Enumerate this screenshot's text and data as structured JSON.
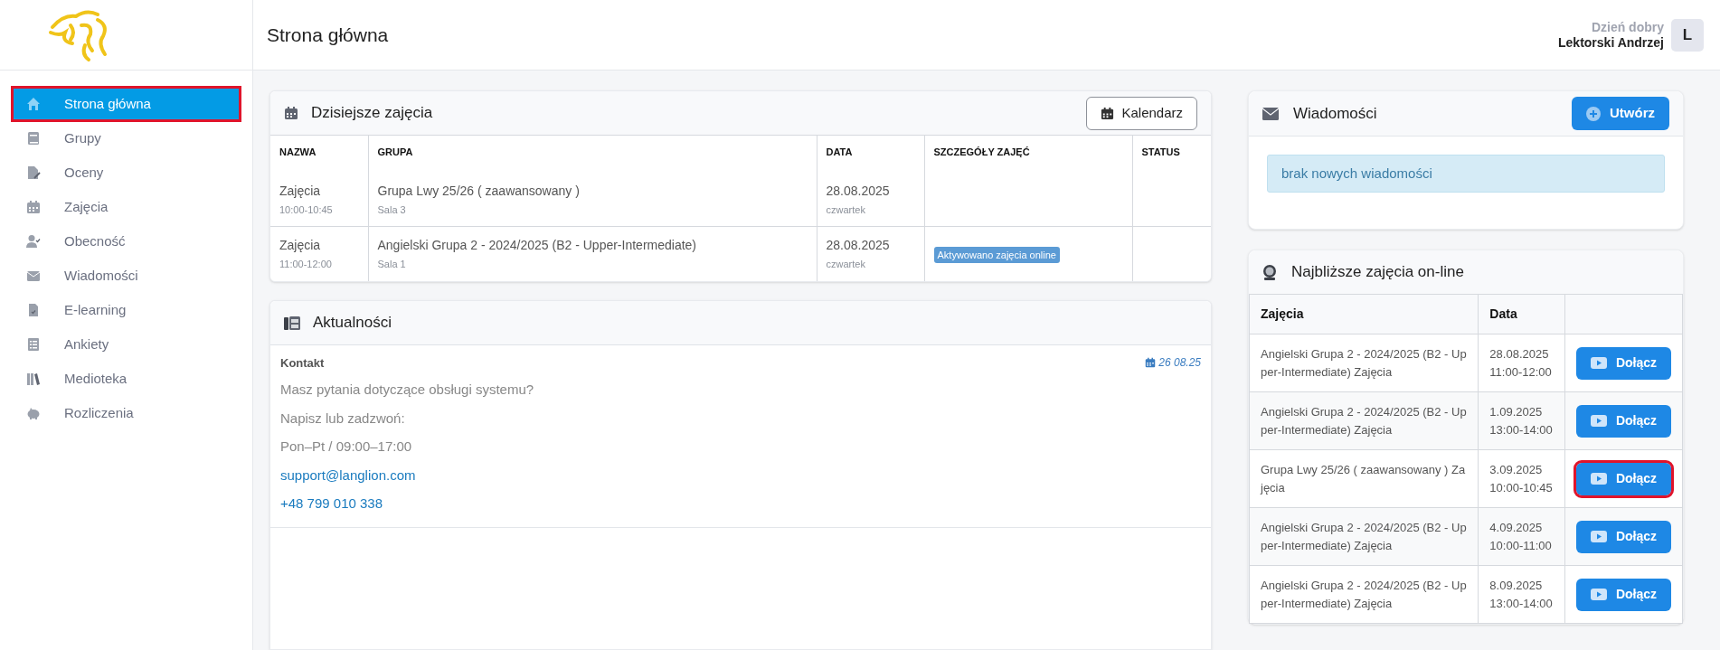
{
  "header": {
    "title": "Strona główna",
    "greeting": "Dzień dobry",
    "user_name": "Lektorski Andrzej",
    "avatar_letter": "L"
  },
  "sidebar": {
    "items": [
      {
        "label": "Strona główna",
        "selected": true,
        "highlighted": true
      },
      {
        "label": "Grupy",
        "selected": false,
        "highlighted": false
      },
      {
        "label": "Oceny",
        "selected": false,
        "highlighted": false
      },
      {
        "label": "Zajęcia",
        "selected": false,
        "highlighted": false
      },
      {
        "label": "Obecność",
        "selected": false,
        "highlighted": false
      },
      {
        "label": "Wiadomości",
        "selected": false,
        "highlighted": false
      },
      {
        "label": "E-learning",
        "selected": false,
        "highlighted": false
      },
      {
        "label": "Ankiety",
        "selected": false,
        "highlighted": false
      },
      {
        "label": "Medioteka",
        "selected": false,
        "highlighted": false
      },
      {
        "label": "Rozliczenia",
        "selected": false,
        "highlighted": false
      }
    ]
  },
  "today": {
    "title": "Dzisiejsze zajęcia",
    "button": "Kalendarz",
    "columns": [
      "NAZWA",
      "GRUPA",
      "DATA",
      "SZCZEGÓŁY ZAJĘĆ",
      "STATUS"
    ],
    "rows": [
      {
        "name": "Zajęcia",
        "time": "10:00-10:45",
        "group": "Grupa Lwy 25/26 ( zaawansowany )",
        "room": "Sala 3",
        "date": "28.08.2025",
        "weekday": "czwartek"
      },
      {
        "name": "Zajęcia",
        "time": "11:00-12:00",
        "group": "Angielski Grupa 2 - 2024/2025 (B2 - Upper-Intermediate)",
        "room": "Sala 1",
        "date": "28.08.2025",
        "weekday": "czwartek",
        "details": "Aktywowano zajęcia online"
      }
    ]
  },
  "news": {
    "title": "Aktualności",
    "items": [
      {
        "title": "Kontakt",
        "date": "26 08.25",
        "lines": [
          {
            "kind": "text",
            "text": "Masz pytania dotyczące obsługi systemu?"
          },
          {
            "kind": "text",
            "text": "Napisz lub zadzwoń:"
          },
          {
            "kind": "text",
            "text": "Pon–Pt / 09:00–17:00"
          },
          {
            "kind": "link",
            "text": "support@langlion.com"
          },
          {
            "kind": "link",
            "text": "+48 799 010 338"
          }
        ]
      }
    ]
  },
  "messages": {
    "title": "Wiadomości",
    "button": "Utwórz",
    "empty_text": "brak nowych wiadomości"
  },
  "online": {
    "title": "Najbliższe zajęcia on-line",
    "columns": [
      "Zajęcia",
      "Data"
    ],
    "rows": [
      {
        "class": "Angielski Grupa 2 - 2024/2025 (B2 - Upper-Intermediate) Zajęcia",
        "date": "28.08.2025",
        "time": "11:00-12:00",
        "button": "Dołącz",
        "highlighted": false
      },
      {
        "class": "Angielski Grupa 2 - 2024/2025 (B2 - Upper-Intermediate) Zajęcia",
        "date": "1.09.2025",
        "time": "13:00-14:00",
        "button": "Dołącz",
        "highlighted": false
      },
      {
        "class": "Grupa Lwy 25/26 ( zaawansowany ) Zajęcia",
        "date": "3.09.2025",
        "time": "10:00-10:45",
        "button": "Dołącz",
        "highlighted": true
      },
      {
        "class": "Angielski Grupa 2 - 2024/2025 (B2 - Upper-Intermediate) Zajęcia",
        "date": "4.09.2025",
        "time": "10:00-11:00",
        "button": "Dołącz",
        "highlighted": false
      },
      {
        "class": "Angielski Grupa 2 - 2024/2025 (B2 - Upper-Intermediate) Zajęcia",
        "date": "8.09.2025",
        "time": "13:00-14:00",
        "button": "Dołącz",
        "highlighted": false
      }
    ]
  }
}
